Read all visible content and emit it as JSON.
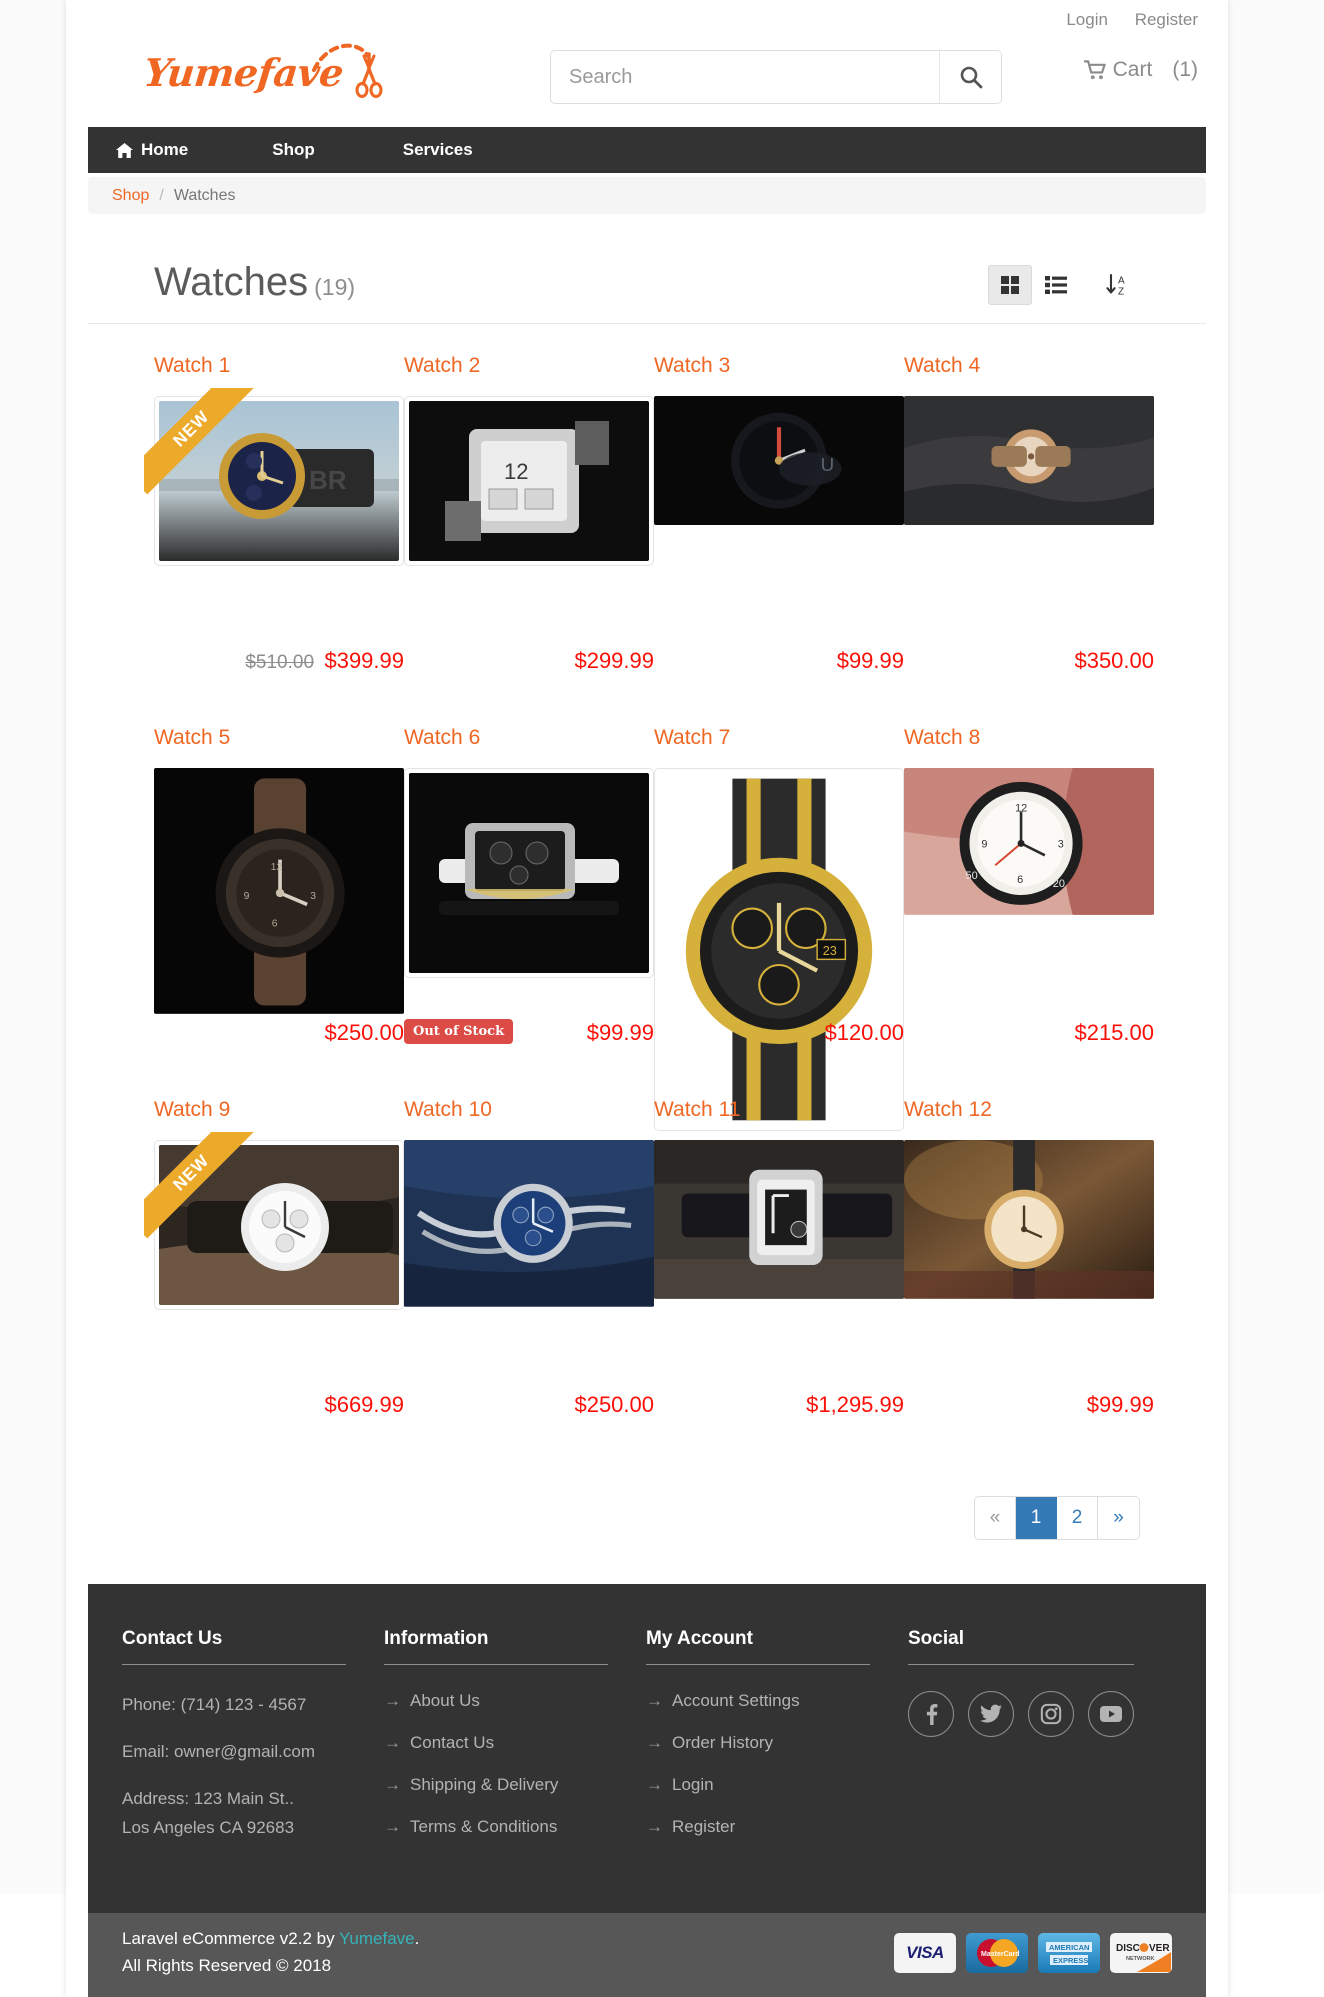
{
  "brand": {
    "name": "Yumefave",
    "accent": "#ef6723"
  },
  "header": {
    "login_label": "Login",
    "register_label": "Register",
    "cart_label": "Cart",
    "cart_count": "(1)",
    "search": {
      "value": "",
      "placeholder": "Search"
    }
  },
  "nav": {
    "items": [
      {
        "label": "Home",
        "icon": "home-icon"
      },
      {
        "label": "Shop",
        "icon": ""
      },
      {
        "label": "Services",
        "icon": ""
      }
    ]
  },
  "breadcrumb": {
    "root": "Shop",
    "separator": "/",
    "current": "Watches"
  },
  "page": {
    "title": "Watches",
    "count": "(19)",
    "views": [
      {
        "name": "grid-view",
        "active": true
      },
      {
        "name": "list-view",
        "active": false
      },
      {
        "name": "sort-az",
        "active": false
      }
    ]
  },
  "products": [
    {
      "name": "Watch 1",
      "price": "$399.99",
      "old_price": "$510.00",
      "badge": "NEW",
      "img": "watch-gold-blue"
    },
    {
      "name": "Watch 2",
      "price": "$299.99",
      "old_price": "",
      "badge": "",
      "img": "watch-bw-square"
    },
    {
      "name": "Watch 3",
      "price": "$99.99",
      "old_price": "",
      "badge": "",
      "img": "watch-dark-red"
    },
    {
      "name": "Watch 4",
      "price": "$350.00",
      "old_price": "",
      "badge": "",
      "img": "watch-rosegold-cloth"
    },
    {
      "name": "Watch 5",
      "price": "$250.00",
      "old_price": "",
      "badge": "",
      "img": "watch-brown-leather"
    },
    {
      "name": "Watch 6",
      "price": "$99.99",
      "old_price": "",
      "badge": "Out of Stock",
      "img": "watch-silver-black"
    },
    {
      "name": "Watch 7",
      "price": "$120.00",
      "old_price": "",
      "badge": "",
      "img": "watch-gold-chrono"
    },
    {
      "name": "Watch 8",
      "price": "$215.00",
      "old_price": "",
      "badge": "",
      "img": "watch-white-dial-pink"
    },
    {
      "name": "Watch 9",
      "price": "$669.99",
      "old_price": "",
      "badge": "NEW",
      "img": "watch-white-wrist"
    },
    {
      "name": "Watch 10",
      "price": "$250.00",
      "old_price": "",
      "badge": "",
      "img": "watch-blue-steel"
    },
    {
      "name": "Watch 11",
      "price": "$1,295.99",
      "old_price": "",
      "badge": "",
      "img": "watch-square-leather"
    },
    {
      "name": "Watch 12",
      "price": "$99.99",
      "old_price": "",
      "badge": "",
      "img": "watch-warm-gold"
    }
  ],
  "pagination": {
    "prev": "«",
    "next": "»",
    "pages": [
      "1",
      "2"
    ],
    "current": "1"
  },
  "footer": {
    "contact": {
      "title": "Contact Us",
      "phone": "Phone: (714) 123 - 4567",
      "email": "Email: owner@gmail.com",
      "address_line1": "Address: 123 Main St..",
      "address_line2": "Los Angeles CA 92683"
    },
    "information": {
      "title": "Information",
      "links": [
        "About Us",
        "Contact Us",
        "Shipping & Delivery",
        "Terms & Conditions"
      ]
    },
    "account": {
      "title": "My Account",
      "links": [
        "Account Settings",
        "Order History",
        "Login",
        "Register"
      ]
    },
    "social": {
      "title": "Social",
      "icons": [
        "facebook-icon",
        "twitter-icon",
        "instagram-icon",
        "youtube-icon"
      ]
    },
    "copyright": {
      "line1_pre": "Laravel eCommerce v2.2 by ",
      "line1_link": "Yumefave",
      "line1_post": ".",
      "line2": "All Rights Reserved © 2018"
    },
    "payments": [
      "VISA",
      "MasterCard",
      "AMERICAN EXPRESS",
      "DISCOVER NETWORK"
    ]
  }
}
